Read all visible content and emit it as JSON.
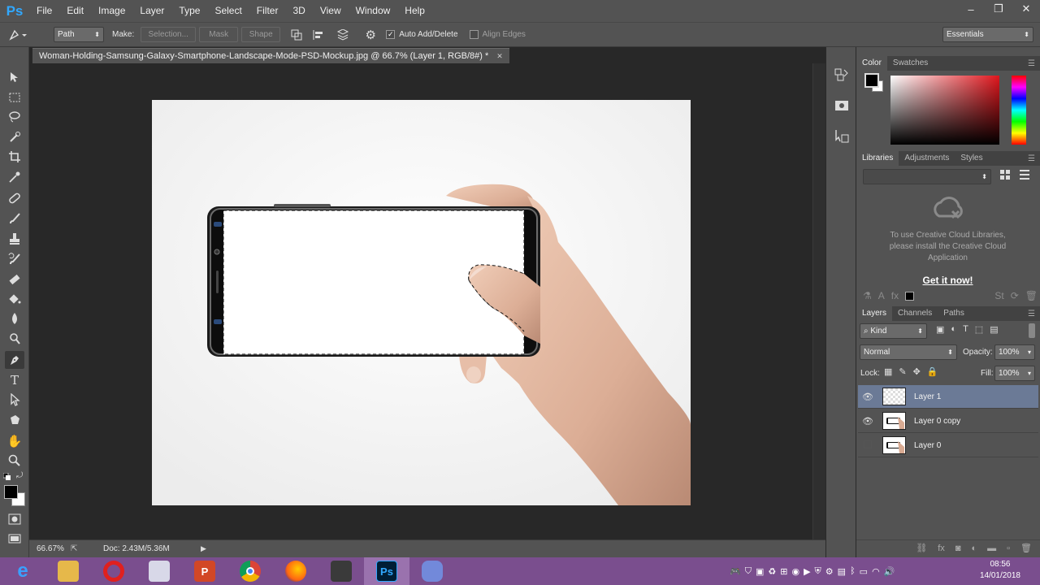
{
  "app": {
    "logo": "Ps"
  },
  "menu": [
    "File",
    "Edit",
    "Image",
    "Layer",
    "Type",
    "Select",
    "Filter",
    "3D",
    "View",
    "Window",
    "Help"
  ],
  "window_controls": {
    "minimize": "–",
    "restore": "❐",
    "close": "✕"
  },
  "options": {
    "mode_value": "Path",
    "make_label": "Make:",
    "selection_label": "Selection...",
    "mask_label": "Mask",
    "shape_label": "Shape",
    "auto_add_delete_label": "Auto Add/Delete",
    "align_edges_label": "Align Edges",
    "workspace_value": "Essentials"
  },
  "document": {
    "tab_title": "Woman-Holding-Samsung-Galaxy-Smartphone-Landscape-Mode-PSD-Mockup.jpg @ 66.7% (Layer 1, RGB/8#) *",
    "tab_close": "✕"
  },
  "status": {
    "zoom": "66.67%",
    "doc_size": "Doc: 2.43M/5.36M"
  },
  "color_panel": {
    "tabs": [
      "Color",
      "Swatches"
    ]
  },
  "libraries_panel": {
    "tabs": [
      "Libraries",
      "Adjustments",
      "Styles"
    ],
    "message": "To use Creative Cloud Libraries, please install the Creative Cloud Application",
    "link": "Get it now!"
  },
  "layers_panel": {
    "tabs": [
      "Layers",
      "Channels",
      "Paths"
    ],
    "filter_value": "Kind",
    "blend_mode": "Normal",
    "opacity_label": "Opacity:",
    "opacity_value": "100%",
    "lock_label": "Lock:",
    "fill_label": "Fill:",
    "fill_value": "100%",
    "layers": [
      {
        "name": "Layer 1",
        "visible": true,
        "selected": true
      },
      {
        "name": "Layer 0 copy",
        "visible": true,
        "selected": false
      },
      {
        "name": "Layer 0",
        "visible": false,
        "selected": false
      }
    ]
  },
  "taskbar": {
    "apps": [
      "Internet Explorer",
      "File Explorer",
      "Opera",
      "Keyboard",
      "PowerPoint",
      "Chrome",
      "Firefox",
      "Terminal",
      "Photoshop",
      "Discord"
    ],
    "time": "08:56",
    "date": "14/01/2018"
  },
  "colors": {
    "panel_bg": "#535353",
    "workspace_bg": "#282828",
    "layer_selected": "#6b7a96",
    "taskbar": "#7a4e8e",
    "link": "#ffffff"
  }
}
